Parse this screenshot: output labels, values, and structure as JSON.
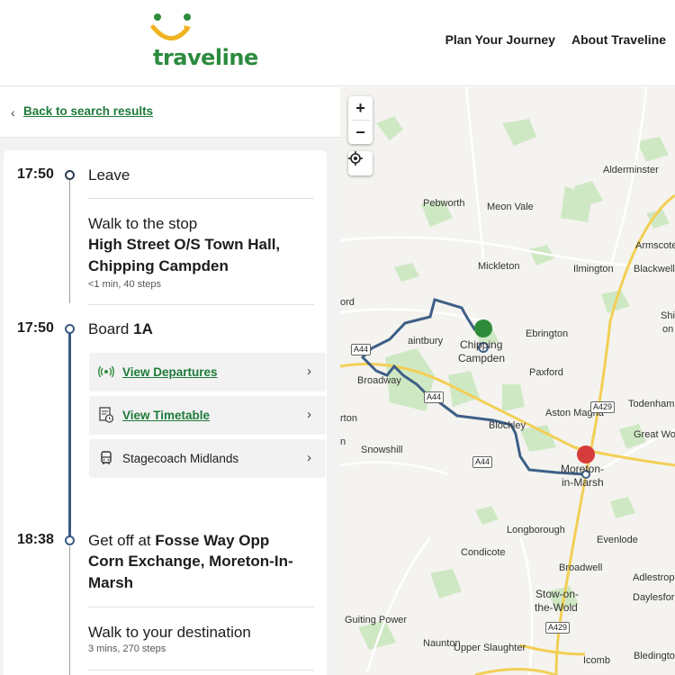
{
  "header": {
    "logo_text": "traveline",
    "nav": [
      "Plan Your Journey",
      "About Traveline"
    ]
  },
  "back": {
    "label": "Back to search results"
  },
  "journey": {
    "leave": {
      "time": "17:50",
      "label": "Leave"
    },
    "walk_to_stop": {
      "title": "Walk to the stop",
      "stop_line1": "High Street O/S Town Hall,",
      "stop_line2": "Chipping Campden",
      "detail": "<1 min, 40 steps"
    },
    "board": {
      "time": "17:50",
      "prefix": "Board",
      "service": "1A",
      "actions": [
        {
          "label": "View Departures",
          "icon": "broadcast-icon"
        },
        {
          "label": "View Timetable",
          "icon": "timetable-icon"
        },
        {
          "label": "Stagecoach Midlands",
          "icon": "bus-icon"
        }
      ]
    },
    "get_off": {
      "time": "18:38",
      "prefix": "Get off at",
      "stop_line1": "Fosse Way Opp",
      "stop_line2": "Corn Exchange, Moreton-In-",
      "stop_line3": "Marsh"
    },
    "walk_to_dest": {
      "title": "Walk to your destination",
      "detail": "3 mins, 270 steps"
    }
  },
  "map": {
    "zoom_in": "+",
    "zoom_out": "−",
    "places": [
      "Alderminster",
      "Pebworth",
      "Meon Vale",
      "Armscote",
      "Mickleton",
      "Ilmington",
      "Blackwell",
      "Shi",
      "on",
      "ord",
      "Chipping",
      "Campden",
      "Ebrington",
      "aintbury",
      "Broadway",
      "Paxford",
      "Todenham",
      "Aston Magna",
      "rton",
      "n",
      "Snowshill",
      "Blockley",
      "Great Wo",
      "Moreton-",
      "in-Marsh",
      "Longborough",
      "Evenlode",
      "Condicote",
      "Broadwell",
      "Adlestrop",
      "Stow-on-",
      "the-Wold",
      "Daylesford",
      "Guiting Power",
      "Naunton",
      "Upper Slaughter",
      "Icomb",
      "Bledington"
    ],
    "roads": [
      "A44",
      "A44",
      "A44",
      "A429",
      "A429"
    ],
    "colors": {
      "route": "#3d5f86",
      "start_pin": "#2e8b3a",
      "end_pin": "#d63b3b",
      "major_road": "#f3cf55"
    }
  }
}
